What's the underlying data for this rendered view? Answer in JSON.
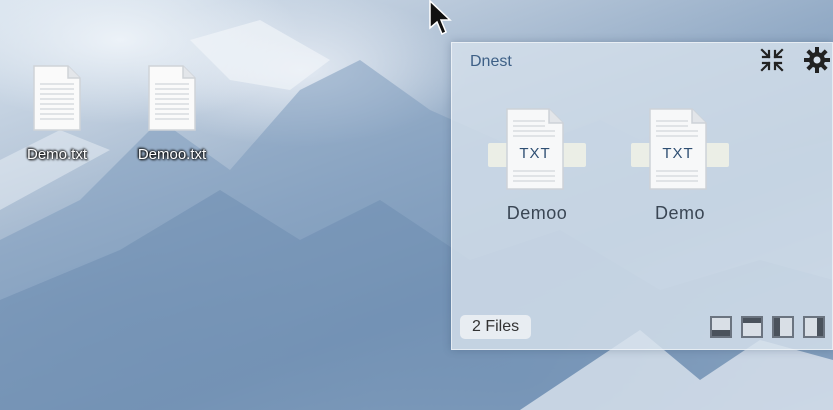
{
  "desktop": {
    "icons": [
      {
        "label": "Demo.txt",
        "icon": "text-file-icon"
      },
      {
        "label": "Demoo.txt",
        "icon": "text-file-icon"
      }
    ]
  },
  "panel": {
    "title": "Dnest",
    "collapse_icon": "collapse-arrows-icon",
    "settings_icon": "gear-icon",
    "files": [
      {
        "ext": "TXT",
        "name": "Demoo"
      },
      {
        "ext": "TXT",
        "name": "Demo"
      }
    ],
    "count_label": "2 Files",
    "layout_buttons": [
      "dock-bottom",
      "dock-top",
      "dock-left",
      "dock-right"
    ],
    "accent_color": "#3d5f86"
  }
}
